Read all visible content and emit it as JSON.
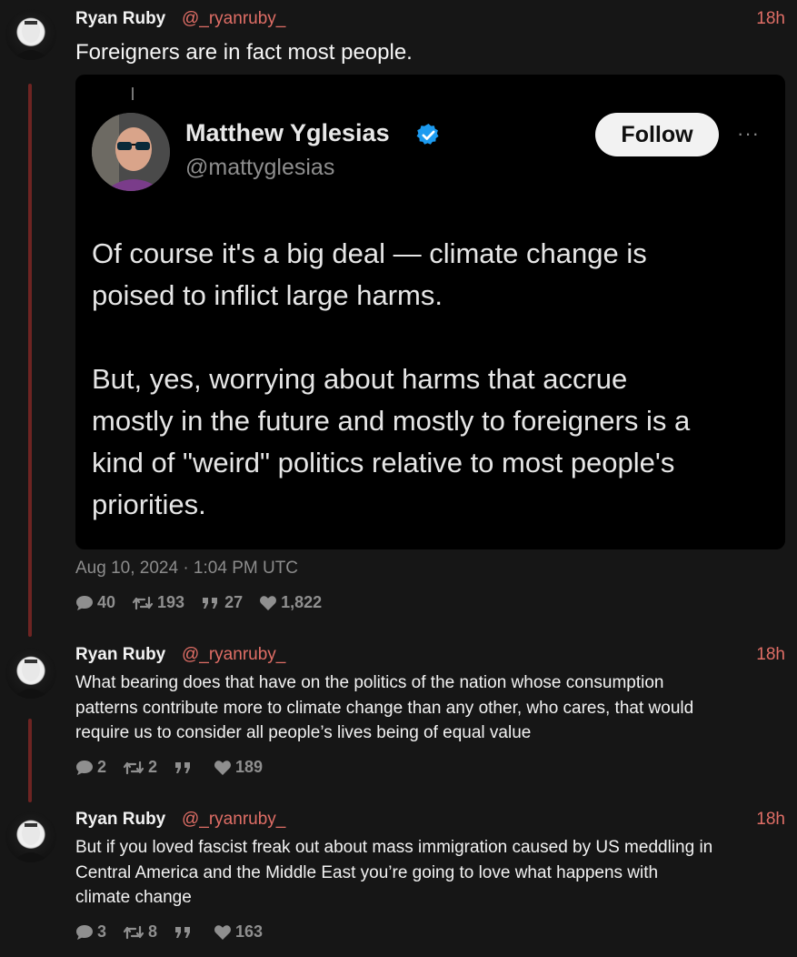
{
  "posts": [
    {
      "author": "Ryan Ruby",
      "handle": "@_ryanruby_",
      "time": "18h",
      "text": "Foreigners are in fact most people.",
      "date": "Aug 10, 2024 · 1:04 PM UTC",
      "stats": {
        "replies": "40",
        "retweets": "193",
        "quotes": "27",
        "likes": "1,822"
      }
    },
    {
      "author": "Ryan Ruby",
      "handle": "@_ryanruby_",
      "time": "18h",
      "text_lines": [
        "What bearing does that have on the politics of the nation whose consumption",
        "patterns contribute more to climate change than any other, who cares, that would",
        "require us to consider all people’s lives being of equal value"
      ],
      "stats": {
        "replies": "2",
        "retweets": "2",
        "quotes": "",
        "likes": "189"
      }
    },
    {
      "author": "Ryan Ruby",
      "handle": "@_ryanruby_",
      "time": "18h",
      "text_lines": [
        "But if you loved fascist freak out about mass immigration caused by US meddling in",
        "Central America and the Middle East you’re going to love what happens with",
        "climate change"
      ],
      "stats": {
        "replies": "3",
        "retweets": "8",
        "quotes": "",
        "likes": "163"
      }
    }
  ],
  "quoted": {
    "name": "Matthew Yglesias",
    "handle": "@mattyglesias",
    "follow_label": "Follow",
    "more": "···",
    "verified_icon": "verified-badge-icon",
    "paragraph1": [
      "Of course it's a big deal — climate change is",
      "poised to inflict large harms."
    ],
    "paragraph2": [
      "But, yes, worrying about harms that accrue",
      "mostly in the future and mostly to foreigners is a",
      "kind of \"weird\" politics relative to most people's",
      "priorities."
    ]
  },
  "colors": {
    "accent": "#e06e66",
    "thread_line": "#6e2422",
    "stat": "#8f8f8f",
    "verified": "#1d9bf0"
  }
}
